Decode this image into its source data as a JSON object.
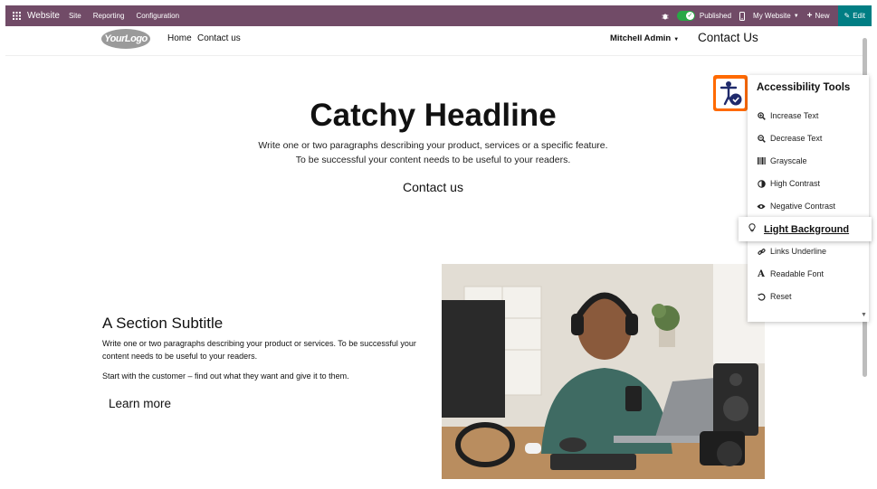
{
  "adminbar": {
    "app_name": "Website",
    "menus": [
      "Site",
      "Reporting",
      "Configuration"
    ],
    "published_label": "Published",
    "website_selector": "My Website",
    "new_label": "New",
    "edit_label": "Edit",
    "brand_color": "#714B67",
    "edit_color": "#017E84"
  },
  "header": {
    "logo_text": "YourLogo",
    "nav": [
      "Home",
      "Contact us"
    ],
    "user": "Mitchell Admin",
    "contact_button": "Contact Us"
  },
  "hero": {
    "headline": "Catchy Headline",
    "para1": "Write one or two paragraphs describing your product, services or a specific feature.",
    "para2": "To be successful your content needs to be useful to your readers.",
    "button": "Contact us"
  },
  "section": {
    "subtitle": "A Section Subtitle",
    "para1": "Write one or two paragraphs describing your product or services. To be successful your content needs to be useful to your readers.",
    "para2": "Start with the customer – find out what they want and give it to them.",
    "button": "Learn more"
  },
  "accessibility": {
    "title": "Accessibility Tools",
    "accent_color": "#ff6a00",
    "items": [
      {
        "label": "Increase Text",
        "icon": "zoom-in-icon"
      },
      {
        "label": "Decrease Text",
        "icon": "zoom-out-icon"
      },
      {
        "label": "Grayscale",
        "icon": "grayscale-icon"
      },
      {
        "label": "High Contrast",
        "icon": "contrast-icon"
      },
      {
        "label": "Negative Contrast",
        "icon": "eye-icon"
      },
      {
        "label": "Light Background",
        "icon": "lightbulb-icon",
        "active": true
      },
      {
        "label": "Links Underline",
        "icon": "link-icon"
      },
      {
        "label": "Readable Font",
        "icon": "font-icon"
      },
      {
        "label": "Reset",
        "icon": "reset-icon"
      }
    ]
  }
}
